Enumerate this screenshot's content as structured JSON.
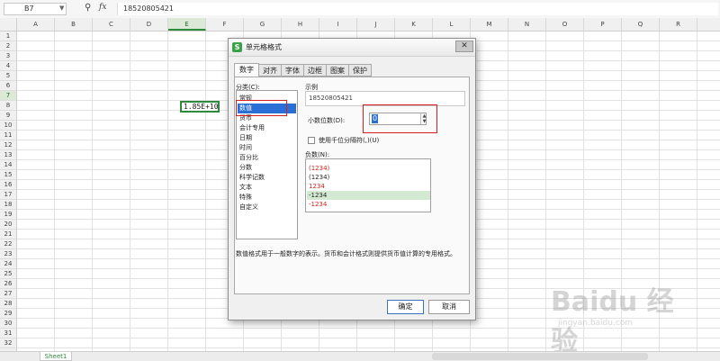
{
  "formula_bar": {
    "name_box": "B7",
    "formula": "18520805421"
  },
  "columns": [
    "A",
    "B",
    "C",
    "D",
    "E",
    "F",
    "G",
    "H",
    "I",
    "J",
    "K",
    "L",
    "M",
    "N",
    "O",
    "P",
    "Q",
    "R"
  ],
  "selected_column": "E",
  "rows": [
    "1",
    "2",
    "3",
    "4",
    "5",
    "6",
    "7",
    "8",
    "9",
    "10",
    "11",
    "12",
    "13",
    "14",
    "15",
    "16",
    "17",
    "18",
    "19",
    "20",
    "21",
    "22",
    "23",
    "24",
    "25",
    "26",
    "27",
    "28",
    "29",
    "30",
    "31",
    "32"
  ],
  "selected_row": "7",
  "active_cell": {
    "value": "1.85E+10"
  },
  "sheet": {
    "tab_label": "Sheet1"
  },
  "watermark": {
    "logo": "Baidu 经验",
    "sub": "jingyan.baidu.com"
  },
  "dialog": {
    "icon_glyph": "S",
    "title": "单元格格式",
    "tabs": [
      "数字",
      "对齐",
      "字体",
      "边框",
      "图案",
      "保护"
    ],
    "active_tab": 0,
    "category_label": "分类(C):",
    "categories": [
      "常规",
      "数值",
      "货币",
      "会计专用",
      "日期",
      "时间",
      "百分比",
      "分数",
      "科学记数",
      "文本",
      "特殊",
      "自定义"
    ],
    "selected_category": 1,
    "sample_label": "示例",
    "sample_value": "18520805421",
    "decimals_label": "小数位数(D):",
    "decimals_value": "0",
    "thousands_label": "使用千位分隔符(,)(U)",
    "negative_label": "负数(N):",
    "negative_numbers": [
      {
        "text": "(1234)",
        "color": "#d62020"
      },
      {
        "text": "(1234)",
        "color": "#222222"
      },
      {
        "text": "1234",
        "color": "#d62020"
      },
      {
        "text": "-1234",
        "color": "#222222"
      },
      {
        "text": "-1234",
        "color": "#d62020"
      }
    ],
    "selected_negative": 3,
    "description": "数值格式用于一般数字的表示。货币和会计格式则提供货币值计算的专用格式。",
    "ok_label": "确定",
    "cancel_label": "取消"
  },
  "colors": {
    "accent_green": "#2f8a3c",
    "highlight_red": "#d61f1f",
    "selection_blue": "#2a6fd6"
  }
}
